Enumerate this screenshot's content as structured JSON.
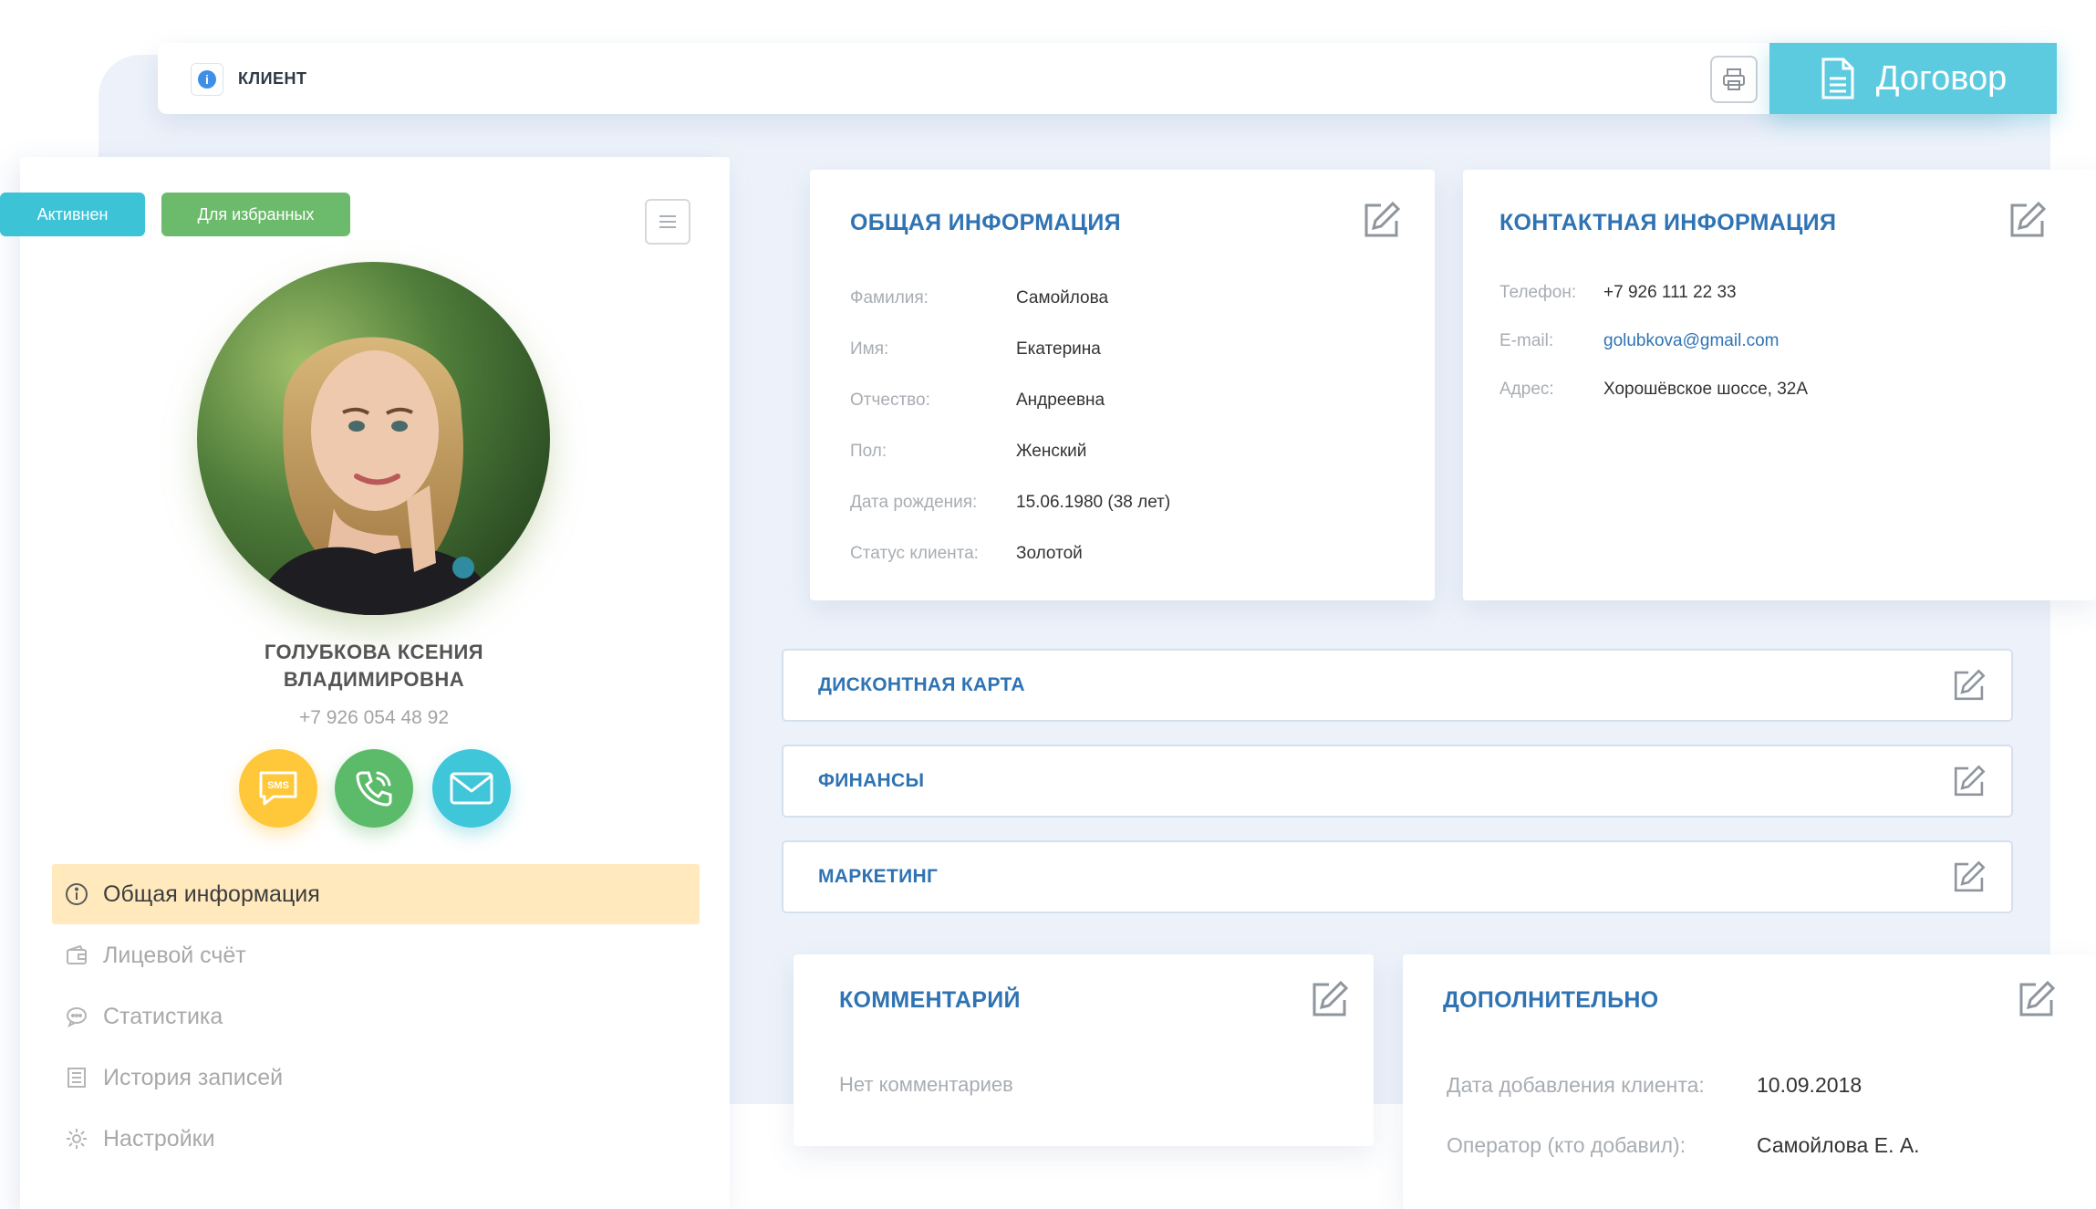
{
  "topbar": {
    "title": "КЛИЕНТ",
    "contract_label": "Договор"
  },
  "profile": {
    "status_active": "Активнен",
    "status_favorite": "Для избранных",
    "name_line1": "ГОЛУБКОВА КСЕНИЯ",
    "name_line2": "ВЛАДИМИРОВНА",
    "phone": "+7 926 054 48 92",
    "sms_label": "SMS"
  },
  "nav": [
    {
      "label": "Общая информация",
      "icon": "info-icon",
      "active": true
    },
    {
      "label": "Лицевой счёт",
      "icon": "wallet-icon",
      "active": false
    },
    {
      "label": "Статистика",
      "icon": "chat-icon",
      "active": false
    },
    {
      "label": "История записей",
      "icon": "list-icon",
      "active": false
    },
    {
      "label": "Настройки",
      "icon": "gear-icon",
      "active": false
    }
  ],
  "general": {
    "title": "ОБЩАЯ ИНФОРМАЦИЯ",
    "fields": [
      {
        "label": "Фамилия:",
        "value": "Самойлова"
      },
      {
        "label": "Имя:",
        "value": "Екатерина"
      },
      {
        "label": "Отчество:",
        "value": "Андреевна"
      },
      {
        "label": "Пол:",
        "value": "Женский"
      },
      {
        "label": "Дата рождения:",
        "value": "15.06.1980 (38 лет)"
      },
      {
        "label": "Статус клиента:",
        "value": "Золотой"
      }
    ]
  },
  "contact": {
    "title": "КОНТАКТНАЯ ИНФОРМАЦИЯ",
    "fields": [
      {
        "label": "Телефон:",
        "value": "+7 926 111 22 33"
      },
      {
        "label": "E-mail:",
        "value": "golubkova@gmail.com"
      },
      {
        "label": "Адрес:",
        "value": "Хорошёвское шоссе, 32А"
      }
    ]
  },
  "sections": {
    "discount": "ДИСКОНТНАЯ КАРТА",
    "finance": "ФИНАНСЫ",
    "marketing": "МАРКЕТИНГ"
  },
  "comment": {
    "title": "КОММЕНТАРИЙ",
    "empty": "Нет комментариев"
  },
  "extra": {
    "title": "ДОПОЛНИТЕЛЬНО",
    "fields": [
      {
        "label": "Дата добавления клиента:",
        "value": "10.09.2018"
      },
      {
        "label": "Оператор (кто добавил):",
        "value": "Самойлова Е. А."
      }
    ]
  },
  "colors": {
    "accent_blue": "#2f73b3",
    "contract_cyan": "#5ccbe0",
    "status_active": "#3cc3d6",
    "status_favorite": "#6cbb6c",
    "sms_yellow": "#ffc83a",
    "call_green": "#5cbb6a",
    "mail_cyan": "#3fc6d8",
    "nav_active_bg": "#ffe9bd"
  }
}
